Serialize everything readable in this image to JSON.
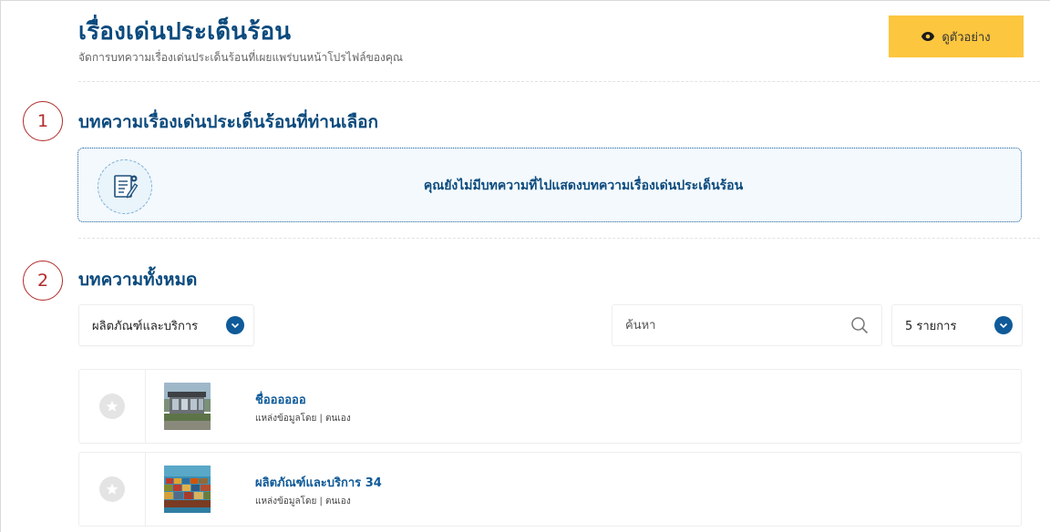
{
  "header": {
    "title": "เรื่องเด่นประเด็นร้อน",
    "subtitle": "จัดการบทความเรื่องเด่นประเด็นร้อนที่เผยแพร่บนหน้าโปรไฟล์ของคุณ",
    "preview_label": "ดูตัวอย่าง",
    "preview_color": "#fcc63f"
  },
  "section1": {
    "step": "1",
    "title": "บทความเรื่องเด่นประเด็นร้อนที่ท่านเลือก",
    "empty_message": "คุณยังไม่มีบทความที่ไปแสดงบทความเรื่องเด่นประเด็นร้อน",
    "empty_icon": "document-edit-icon"
  },
  "section2": {
    "step": "2",
    "title": "บทความทั้งหมด",
    "category_select": "ผลิตภัณฑ์และบริการ",
    "search_placeholder": "ค้นหา",
    "page_size_select": "5 รายการ",
    "articles": [
      {
        "title": "ชื่ออออออ",
        "source": "แหล่งข้อมูลโดย | ตนเอง",
        "thumbnail": "house-photo"
      },
      {
        "title": "ผลิตภัณฑ์และบริการ 34",
        "source": "แหล่งข้อมูลโดย | ตนเอง",
        "thumbnail": "container-ship-photo"
      }
    ]
  },
  "colors": {
    "heading": "#0b4a7d",
    "accent": "#0f5a99",
    "step_circle": "#b22a2a"
  }
}
